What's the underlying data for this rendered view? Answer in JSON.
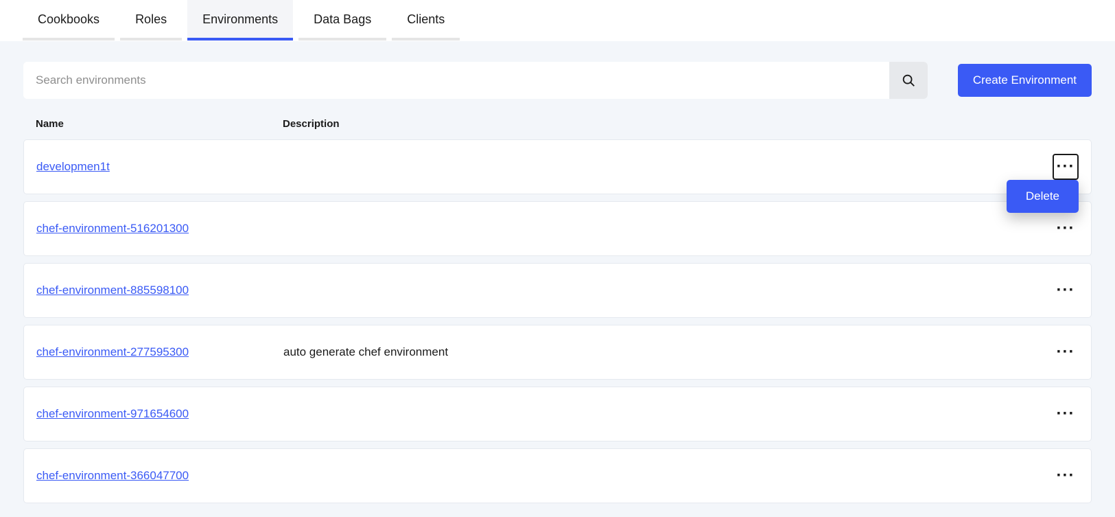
{
  "tabs": [
    {
      "label": "Cookbooks"
    },
    {
      "label": "Roles"
    },
    {
      "label": "Environments"
    },
    {
      "label": "Data Bags"
    },
    {
      "label": "Clients"
    }
  ],
  "search": {
    "placeholder": "Search environments"
  },
  "create_button": "Create Environment",
  "columns": {
    "name": "Name",
    "description": "Description"
  },
  "rows": [
    {
      "name": "developmen1t",
      "description": ""
    },
    {
      "name": "chef-environment-516201300",
      "description": ""
    },
    {
      "name": "chef-environment-885598100",
      "description": ""
    },
    {
      "name": "chef-environment-277595300",
      "description": "auto generate chef environment"
    },
    {
      "name": "chef-environment-971654600",
      "description": ""
    },
    {
      "name": "chef-environment-366047700",
      "description": ""
    }
  ],
  "more_glyph": "···",
  "popover": {
    "delete": "Delete"
  }
}
